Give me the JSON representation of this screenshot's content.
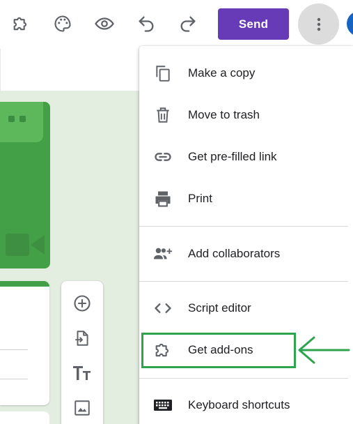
{
  "toolbar": {
    "send_label": "Send",
    "icons": [
      "addons-puzzle-icon",
      "palette-icon",
      "preview-eye-icon",
      "undo-icon",
      "redo-icon",
      "more-vert-icon"
    ]
  },
  "menu": {
    "items": [
      {
        "label": "Make a copy",
        "icon": "copy-icon"
      },
      {
        "label": "Move to trash",
        "icon": "trash-icon"
      },
      {
        "label": "Get pre-filled link",
        "icon": "link-icon"
      },
      {
        "label": "Print",
        "icon": "printer-icon"
      },
      {
        "label": "Add collaborators",
        "icon": "add-people-icon"
      },
      {
        "label": "Script editor",
        "icon": "code-icon"
      },
      {
        "label": "Get add-ons",
        "icon": "puzzle-icon"
      },
      {
        "label": "Keyboard shortcuts",
        "icon": "keyboard-icon"
      }
    ]
  },
  "colors": {
    "send_bg": "#673ab7",
    "header_green": "#43a047",
    "canvas_bg": "#e3eee1",
    "highlight": "#2ea44f"
  },
  "side_tools": [
    "add-question-icon",
    "import-question-icon",
    "title-text-icon",
    "image-icon"
  ]
}
